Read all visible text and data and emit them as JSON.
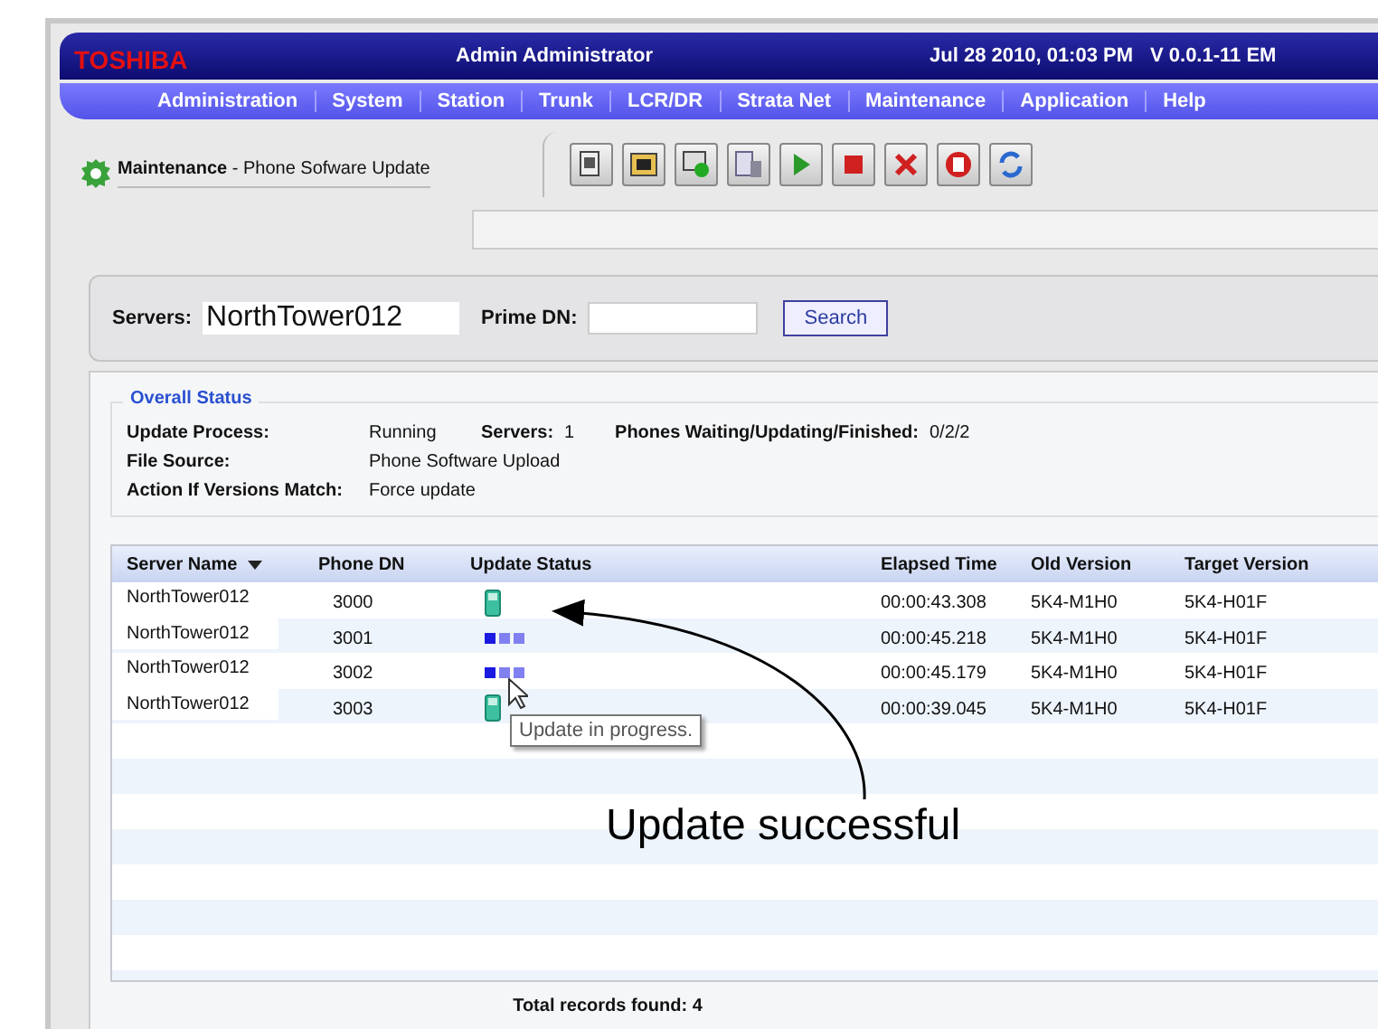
{
  "header": {
    "logo": "TOSHIBA",
    "user": "Admin  Administrator",
    "datetime": "Jul 28 2010, 01:03 PM",
    "version": "V 0.0.1-11 EM"
  },
  "menu": [
    "Administration",
    "System",
    "Station",
    "Trunk",
    "LCR/DR",
    "Strata Net",
    "Maintenance",
    "Application",
    "Help"
  ],
  "page_title": "**Maintenance** - Phone Sofware Update",
  "search": {
    "servers_label": "Servers:",
    "servers_value": "NorthTower012",
    "prime_dn_label": "Prime DN:",
    "button": "Search"
  },
  "overall_status": {
    "title": "Overall Status",
    "update_process": {
      "label": "Update Process:",
      "value": "Running"
    },
    "servers": {
      "label": "Servers:",
      "value": "1"
    },
    "phones": {
      "label": "Phones Waiting/Updating/Finished:",
      "value": "0/2/2"
    },
    "file_source": {
      "label": "File Source:",
      "value": "Phone Software Upload"
    },
    "action": {
      "label": "Action If Versions Match:",
      "value": "Force update"
    }
  },
  "table": {
    "columns": [
      "Server Name",
      "Phone DN",
      "Update Status",
      "Elapsed Time",
      "Old Version",
      "Target Version"
    ],
    "rows": [
      {
        "server": "NorthTower012",
        "dn": "3000",
        "kind": "done",
        "elapsed": "00:00:43.308",
        "old": "5K4-M1H0",
        "target": "5K4-H01F"
      },
      {
        "server": "NorthTower012",
        "dn": "3001",
        "kind": "progress",
        "elapsed": "00:00:45.218",
        "old": "5K4-M1H0",
        "target": "5K4-H01F"
      },
      {
        "server": "NorthTower012",
        "dn": "3002",
        "kind": "progress",
        "elapsed": "00:00:45.179",
        "old": "5K4-M1H0",
        "target": "5K4-H01F"
      },
      {
        "server": "NorthTower012",
        "dn": "3003",
        "kind": "done",
        "elapsed": "00:00:39.045",
        "old": "5K4-M1H0",
        "target": "5K4-H01F"
      }
    ]
  },
  "tooltip": "Update in progress.",
  "total": "Total records found: 4",
  "annotation": "Update successful"
}
